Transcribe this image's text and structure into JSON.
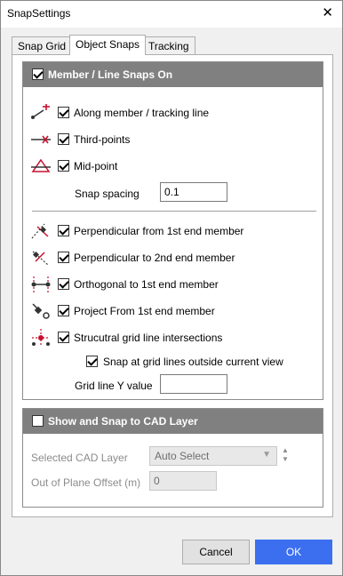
{
  "window": {
    "title": "SnapSettings",
    "close_symbol": "✕"
  },
  "tabs": [
    {
      "label": "Snap Grid",
      "active": false
    },
    {
      "label": "Object Snaps",
      "active": true
    },
    {
      "label": "Tracking",
      "active": false
    }
  ],
  "member_group": {
    "header": "Member / Line Snaps On",
    "checked": true,
    "options_a": [
      {
        "label": "Along member / tracking line",
        "icon": "along-line-icon",
        "checked": true
      },
      {
        "label": "Third-points",
        "icon": "third-points-icon",
        "checked": true
      },
      {
        "label": "Mid-point",
        "icon": "mid-point-icon",
        "checked": true
      }
    ],
    "snap_spacing": {
      "label": "Snap spacing",
      "value": "0.1"
    },
    "options_b": [
      {
        "label": "Perpendicular from 1st end member",
        "icon": "perpendicular-from-icon",
        "checked": true
      },
      {
        "label": "Perpendicular to 2nd end member",
        "icon": "perpendicular-to-icon",
        "checked": true
      },
      {
        "label": "Orthogonal to 1st end member",
        "icon": "orthogonal-icon",
        "checked": true
      },
      {
        "label": "Project From 1st end member",
        "icon": "project-from-icon",
        "checked": true
      },
      {
        "label": "Strucutral grid line intersections",
        "icon": "grid-intersection-icon",
        "checked": true
      }
    ],
    "outside_view": {
      "label": "Snap at grid lines outside current view",
      "checked": true
    },
    "grid_y": {
      "label": "Grid line Y value",
      "value": ""
    }
  },
  "cad_group": {
    "header": "Show and Snap to CAD Layer",
    "checked": false,
    "selected_layer": {
      "label": "Selected CAD Layer",
      "value": "Auto Select"
    },
    "offset": {
      "label": "Out of Plane Offset (m)",
      "value": "0"
    }
  },
  "buttons": {
    "cancel": "Cancel",
    "ok": "OK"
  },
  "colors": {
    "accent": "#3c6ff0",
    "header_bg": "#808080",
    "icon_red": "#c8102e"
  }
}
